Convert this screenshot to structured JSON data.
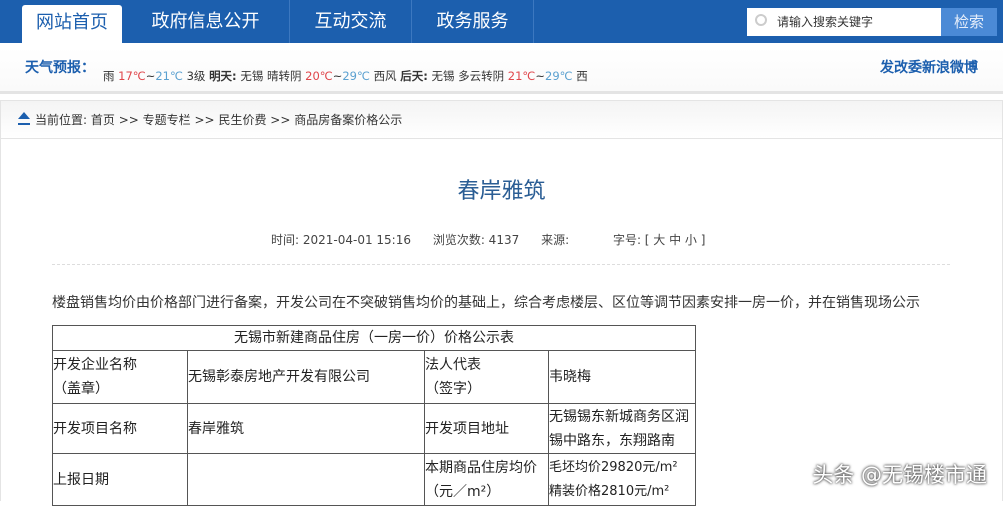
{
  "nav": {
    "tabs": [
      "网站首页",
      "政府信息公开",
      "互动交流",
      "政务服务"
    ],
    "search_placeholder": "请输入搜索关键字",
    "search_button": "检索"
  },
  "weather": {
    "label": "天气预报：",
    "today_cond": "雨",
    "today_low": "17℃",
    "today_high": "21℃",
    "today_wind": "3级",
    "tomorrow_label": "明天:",
    "tomorrow_city": "无锡",
    "tomorrow_cond": "晴转阴",
    "tomorrow_low": "20℃",
    "tomorrow_high": "29℃",
    "tomorrow_wind": "西风",
    "after_label": "后天:",
    "after_city": "无锡",
    "after_cond": "多云转阴",
    "after_low": "21℃",
    "after_high": "29℃",
    "after_wind": "西",
    "weibo": "发改委新浪微博"
  },
  "breadcrumb": {
    "prefix": "当前位置:",
    "items": [
      "首页",
      "专题专栏",
      "民生价费",
      "商品房备案价格公示"
    ],
    "sep": ">>"
  },
  "article": {
    "title": "春岸雅筑",
    "time": "时间: 2021-04-01 15:16",
    "views": "浏览次数: 4137",
    "source": "来源:",
    "fontsize": "字号: [ 大 中 小 ]",
    "intro": "楼盘销售均价由价格部门进行备案，开发公司在不突破销售均价的基础上，综合考虑楼层、区位等调节因素安排一房一价，并在销售现场公示"
  },
  "table": {
    "caption": "无锡市新建商品住房（一房一价）价格公示表",
    "rows": [
      [
        "开发企业名称\n（盖章）",
        "无锡彰泰房地产开发有限公司",
        "法人代表\n（签字）",
        "韦晓梅"
      ],
      [
        "开发项目名称",
        "春岸雅筑",
        "开发项目地址",
        "无锡锡东新城商务区润锡中路东，东翔路南"
      ],
      [
        "上报日期",
        "",
        "本期商品住房均价\n（元／m²）",
        "毛坯均价29820元/m²\n精装价格2810元/m²"
      ]
    ]
  },
  "watermark": "头条 @无锡楼市通"
}
